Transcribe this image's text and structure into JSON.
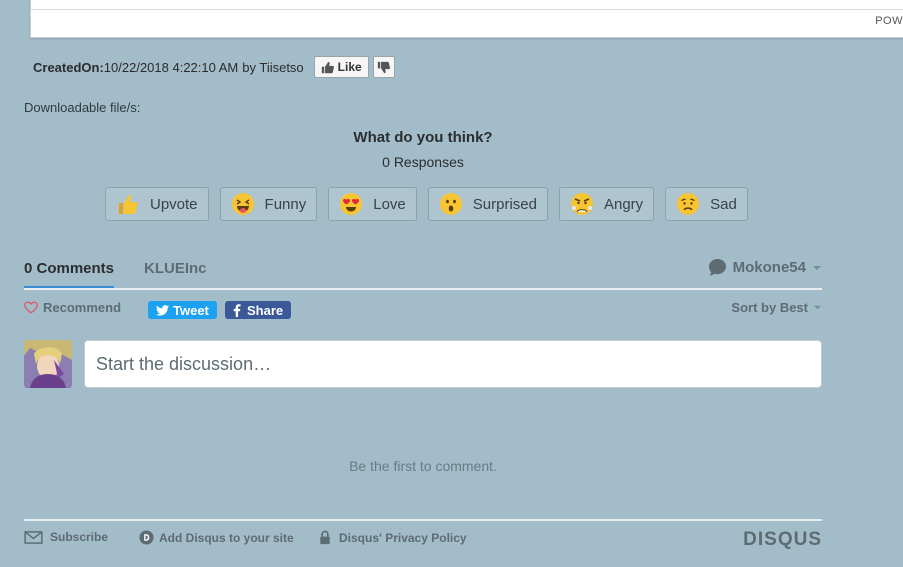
{
  "topcard": {
    "powered_text": "POW"
  },
  "meta": {
    "created_label": "CreatedOn:",
    "created_value": "10/22/2018 4:22:10 AM",
    "by_text": "by Tiisetso",
    "like_label": "Like"
  },
  "downloadable_label": "Downloadable file/s:",
  "reactions_header": {
    "question": "What do you think?",
    "responses": "0 Responses"
  },
  "reactions": [
    {
      "label": "Upvote",
      "icon": "thumbs-up-emoji-icon"
    },
    {
      "label": "Funny",
      "icon": "tongue-out-emoji-icon"
    },
    {
      "label": "Love",
      "icon": "heart-eyes-emoji-icon"
    },
    {
      "label": "Surprised",
      "icon": "surprised-emoji-icon"
    },
    {
      "label": "Angry",
      "icon": "angry-emoji-icon"
    },
    {
      "label": "Sad",
      "icon": "sad-emoji-icon"
    }
  ],
  "tabs": {
    "comments": "0 Comments",
    "forum": "KLUEInc",
    "username": "Mokone54"
  },
  "actions": {
    "recommend": "Recommend",
    "tweet": "Tweet",
    "share": "Share",
    "sort": "Sort by Best"
  },
  "composer": {
    "placeholder": "Start the discussion…"
  },
  "empty_state": "Be the first to comment.",
  "footer": {
    "subscribe": "Subscribe",
    "add_disqus": "Add Disqus to your site",
    "privacy": "Disqus' Privacy Policy",
    "logo": "DISQUS"
  },
  "colors": {
    "background": "#a3bcc9",
    "accent": "#3a8dd5",
    "twitter": "#1da1f2",
    "facebook": "#3b5998",
    "muted_text": "#5d6b73"
  }
}
